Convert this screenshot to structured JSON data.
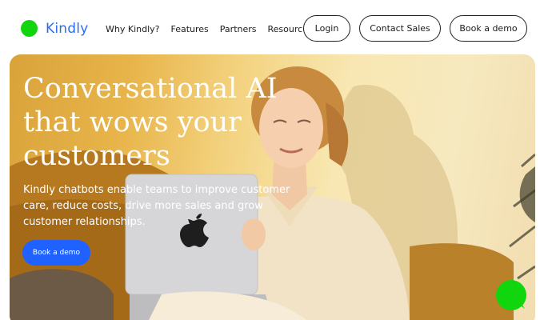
{
  "brand": {
    "name": "Kindly",
    "logo_color": "#12d60d",
    "text_color": "#2d6cf2"
  },
  "nav": {
    "items": [
      "Why Kindly?",
      "Features",
      "Partners",
      "Resources"
    ]
  },
  "header_buttons": {
    "login": "Login",
    "contact": "Contact Sales",
    "demo": "Book a demo"
  },
  "hero": {
    "title": "Conversational AI that wows your customers",
    "subtitle": "Kindly chatbots enable teams to improve customer care, reduce costs, drive more sales and grow customer relationships.",
    "cta": "Book a demo",
    "cta_color": "#1f62ff"
  },
  "chat_widget": {
    "icon": "chat-bubble-icon",
    "color": "#12d60d"
  }
}
